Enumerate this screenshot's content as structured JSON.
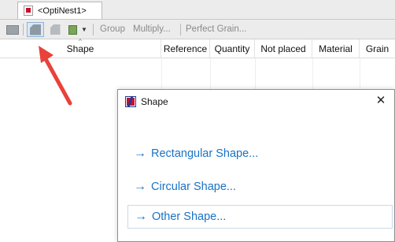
{
  "tab": {
    "label": "<OptiNest1>"
  },
  "toolbar": {
    "group": "Group",
    "multiply": "Multiply...",
    "perfect_grain": "Perfect Grain..."
  },
  "grid": {
    "columns": [
      "Shape",
      "Reference",
      "Quantity",
      "Not placed",
      "Material",
      "Grain"
    ]
  },
  "dialog": {
    "title": "Shape",
    "close_glyph": "✕",
    "options": [
      "Rectangular Shape...",
      "Circular Shape...",
      "Other Shape..."
    ],
    "arrow_glyph": "→"
  },
  "colors": {
    "link": "#1a72c4",
    "annotation_arrow": "#e8423a",
    "toolbar_bg": "#ececec"
  },
  "icons": [
    "document-icon",
    "rectangle-icon",
    "shape-icon",
    "export-icon",
    "dropdown-icon",
    "app-logo-icon",
    "close-icon",
    "arrow-right-icon"
  ]
}
